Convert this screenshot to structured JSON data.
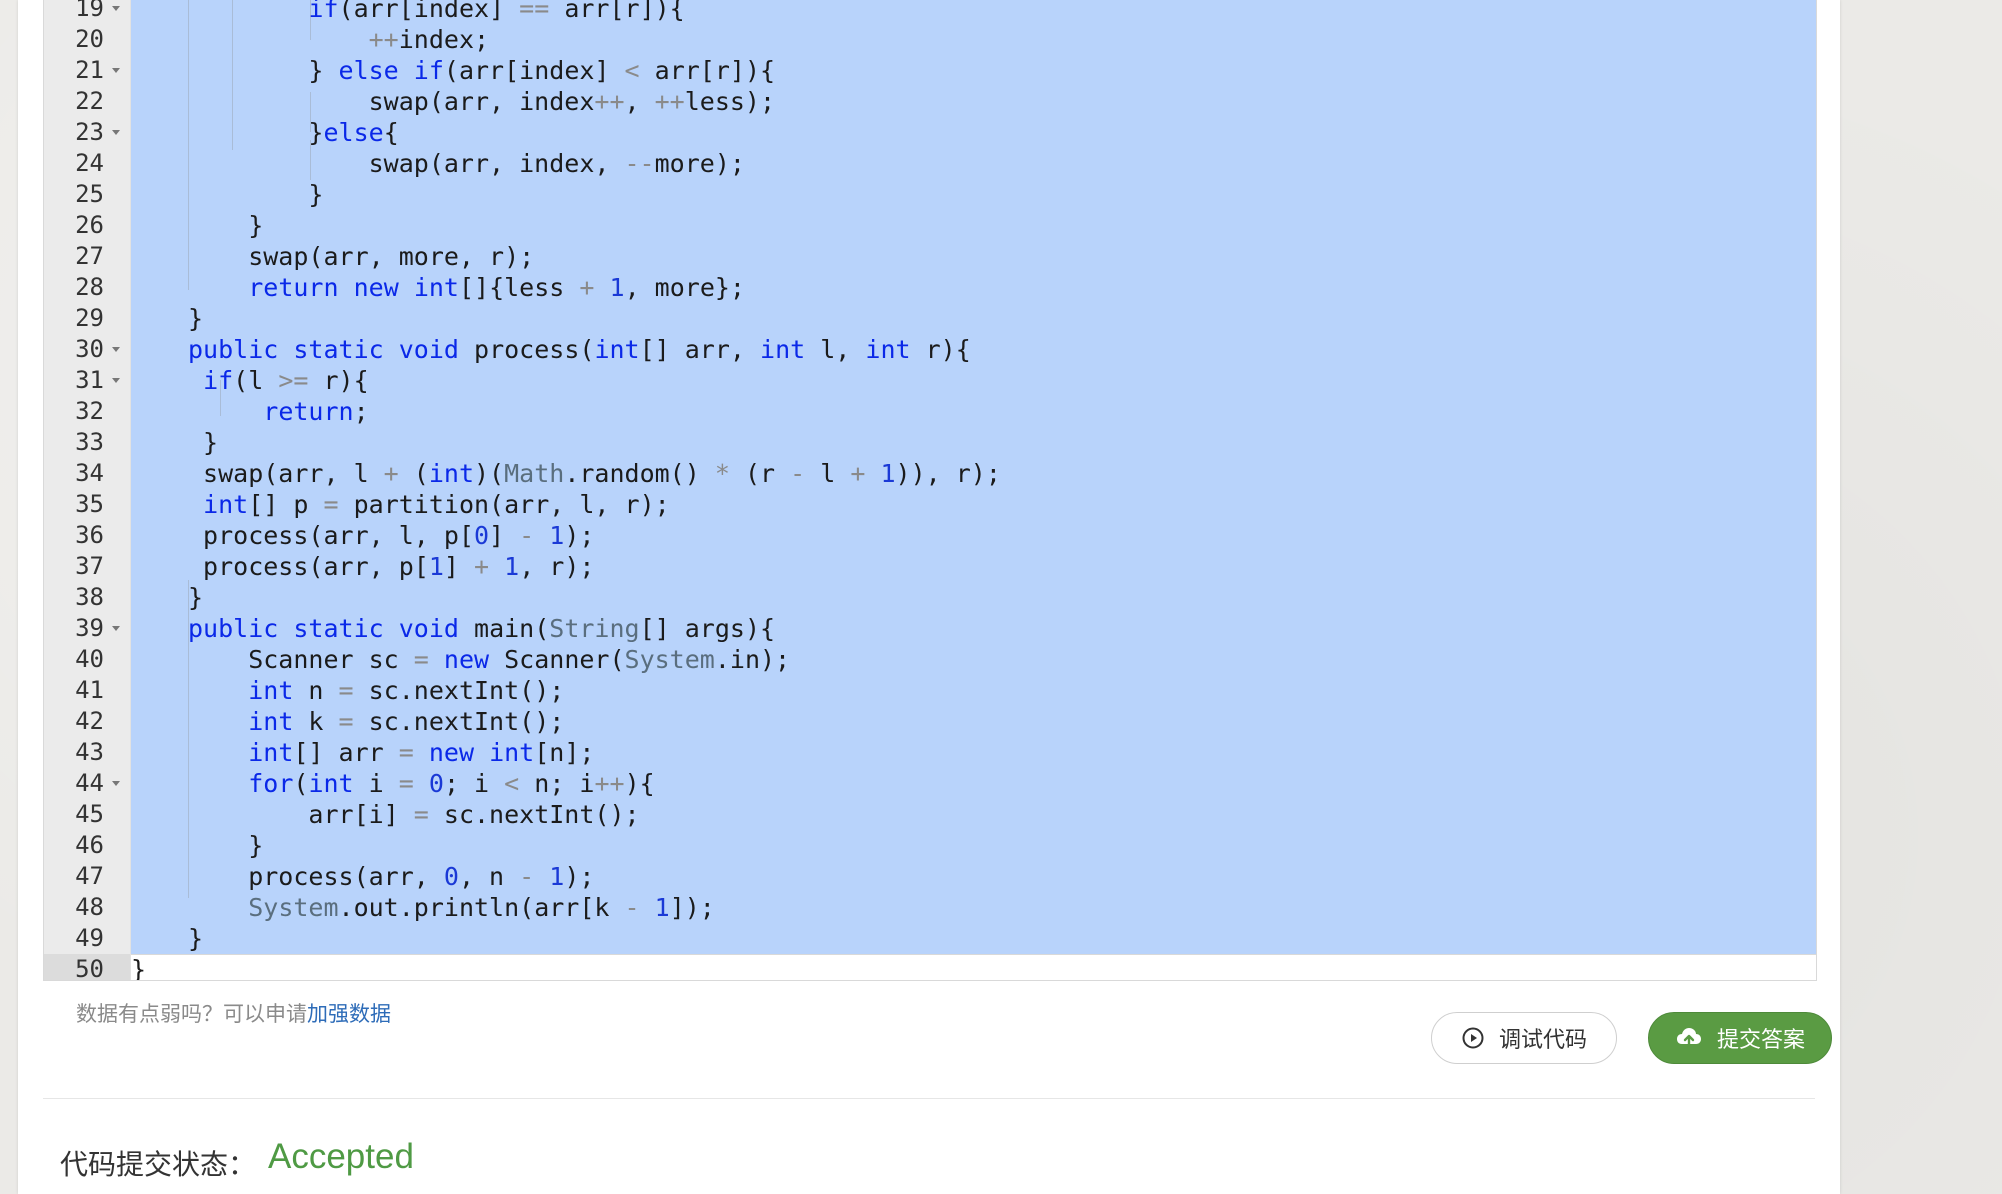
{
  "editor": {
    "lines": [
      {
        "n": "19",
        "fold": true,
        "html": "        <span class=\"kw\">if</span>(arr[index] <span class=\"op\">==</span> arr[r]){"
      },
      {
        "n": "20",
        "fold": false,
        "html": "            <span class=\"op\">++</span>index;"
      },
      {
        "n": "21",
        "fold": true,
        "html": "        } <span class=\"kw\">else</span> <span class=\"kw\">if</span>(arr[index] <span class=\"op\">&lt;</span> arr[r]){"
      },
      {
        "n": "22",
        "fold": false,
        "html": "            swap(arr, index<span class=\"op\">++</span>, <span class=\"op\">++</span>less);"
      },
      {
        "n": "23",
        "fold": true,
        "html": "        }<span class=\"kw\">else</span>{"
      },
      {
        "n": "24",
        "fold": false,
        "html": "            swap(arr, index, <span class=\"op\">--</span>more);"
      },
      {
        "n": "25",
        "fold": false,
        "html": "        }"
      },
      {
        "n": "26",
        "fold": false,
        "html": "    }"
      },
      {
        "n": "27",
        "fold": false,
        "html": "    swap(arr, more, r);"
      },
      {
        "n": "28",
        "fold": false,
        "html": "    <span class=\"kw\">return</span> <span class=\"kw\">new</span> <span class=\"kw\">int</span>[]{less <span class=\"op\">+</span> <span class=\"num\">1</span>, more};"
      },
      {
        "n": "29",
        "fold": false,
        "html": "}"
      },
      {
        "n": "30",
        "fold": true,
        "html": "<span class=\"kw\">public</span> <span class=\"kw\">static</span> <span class=\"kw\">void</span> process(<span class=\"kw\">int</span>[] arr, <span class=\"kw\">int</span> l, <span class=\"kw\">int</span> r){"
      },
      {
        "n": "31",
        "fold": true,
        "html": " <span class=\"kw\">if</span>(l <span class=\"op\">&gt;=</span> r){"
      },
      {
        "n": "32",
        "fold": false,
        "html": "     <span class=\"kw\">return</span>;"
      },
      {
        "n": "33",
        "fold": false,
        "html": " }"
      },
      {
        "n": "34",
        "fold": false,
        "html": " swap(arr, l <span class=\"op\">+</span> (<span class=\"kw\">int</span>)(<span class=\"ty\">Math</span>.random() <span class=\"op\">*</span> (r <span class=\"op\">-</span> l <span class=\"op\">+</span> <span class=\"num\">1</span>)), r);"
      },
      {
        "n": "35",
        "fold": false,
        "html": " <span class=\"kw\">int</span>[] p <span class=\"op\">=</span> partition(arr, l, r);"
      },
      {
        "n": "36",
        "fold": false,
        "html": " process(arr, l, p[<span class=\"num\">0</span>] <span class=\"op\">-</span> <span class=\"num\">1</span>);"
      },
      {
        "n": "37",
        "fold": false,
        "html": " process(arr, p[<span class=\"num\">1</span>] <span class=\"op\">+</span> <span class=\"num\">1</span>, r);"
      },
      {
        "n": "38",
        "fold": false,
        "html": "}"
      },
      {
        "n": "39",
        "fold": true,
        "html": "<span class=\"kw\">public</span> <span class=\"kw\">static</span> <span class=\"kw\">void</span> main(<span class=\"ty\">String</span>[] args){"
      },
      {
        "n": "40",
        "fold": false,
        "html": "    Scanner sc <span class=\"op\">=</span> <span class=\"kw\">new</span> Scanner(<span class=\"ty\">System</span>.in);"
      },
      {
        "n": "41",
        "fold": false,
        "html": "    <span class=\"kw\">int</span> n <span class=\"op\">=</span> sc.nextInt();"
      },
      {
        "n": "42",
        "fold": false,
        "html": "    <span class=\"kw\">int</span> k <span class=\"op\">=</span> sc.nextInt();"
      },
      {
        "n": "43",
        "fold": false,
        "html": "    <span class=\"kw\">int</span>[] arr <span class=\"op\">=</span> <span class=\"kw\">new</span> <span class=\"kw\">int</span>[n];"
      },
      {
        "n": "44",
        "fold": true,
        "html": "    <span class=\"kw\">for</span>(<span class=\"kw\">int</span> i <span class=\"op\">=</span> <span class=\"num\">0</span>; i <span class=\"op\">&lt;</span> n; i<span class=\"op\">++</span>){"
      },
      {
        "n": "45",
        "fold": false,
        "html": "        arr[i] <span class=\"op\">=</span> sc.nextInt();"
      },
      {
        "n": "46",
        "fold": false,
        "html": "    }"
      },
      {
        "n": "47",
        "fold": false,
        "html": "    process(arr, <span class=\"num\">0</span>, n <span class=\"op\">-</span> <span class=\"num\">1</span>);"
      },
      {
        "n": "48",
        "fold": false,
        "html": "    <span class=\"ty\">System</span>.out.println(arr[k <span class=\"op\">-</span> <span class=\"num\">1</span>]);"
      },
      {
        "n": "49",
        "fold": false,
        "html": "}"
      },
      {
        "n": "50",
        "fold": false,
        "html": "}"
      }
    ]
  },
  "hint": {
    "text": "数据有点弱吗？可以申请",
    "link": "加强数据"
  },
  "buttons": {
    "debug_label": "调试代码",
    "submit_label": "提交答案"
  },
  "status": {
    "label": "代码提交状态：",
    "value": "Accepted"
  },
  "colors": {
    "selection": "#b8d3fb",
    "submit_button": "#5a9b43",
    "accepted": "#4f9a44",
    "link": "#2e6cb8"
  }
}
